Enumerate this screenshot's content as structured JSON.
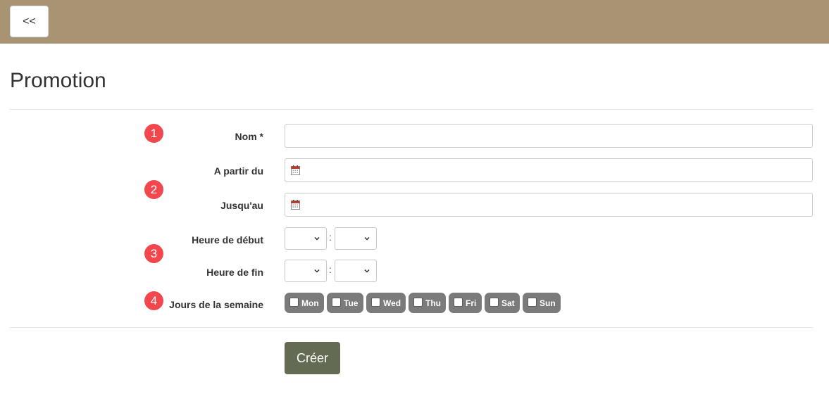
{
  "header": {
    "back_label": "<<"
  },
  "page": {
    "title": "Promotion"
  },
  "badges": [
    "1",
    "2",
    "3",
    "4"
  ],
  "form": {
    "name": {
      "label": "Nom *",
      "value": ""
    },
    "start_date": {
      "label": "A partir du",
      "value": ""
    },
    "end_date": {
      "label": "Jusqu'au",
      "value": ""
    },
    "start_time": {
      "label": "Heure de début",
      "separator": ":",
      "hour": "",
      "minute": ""
    },
    "end_time": {
      "label": "Heure de fin",
      "separator": ":",
      "hour": "",
      "minute": ""
    },
    "weekdays": {
      "label": "Jours de la semaine",
      "days": [
        "Mon",
        "Tue",
        "Wed",
        "Thu",
        "Fri",
        "Sat",
        "Sun"
      ]
    },
    "submit_label": "Créer"
  },
  "colors": {
    "header_bg": "#a89372",
    "badge": "#f2474d",
    "day_button": "#7b7b7b",
    "submit_button": "#636c52"
  },
  "icons": {
    "date_field": "calendar-icon",
    "select": "chevron-down-icon"
  }
}
